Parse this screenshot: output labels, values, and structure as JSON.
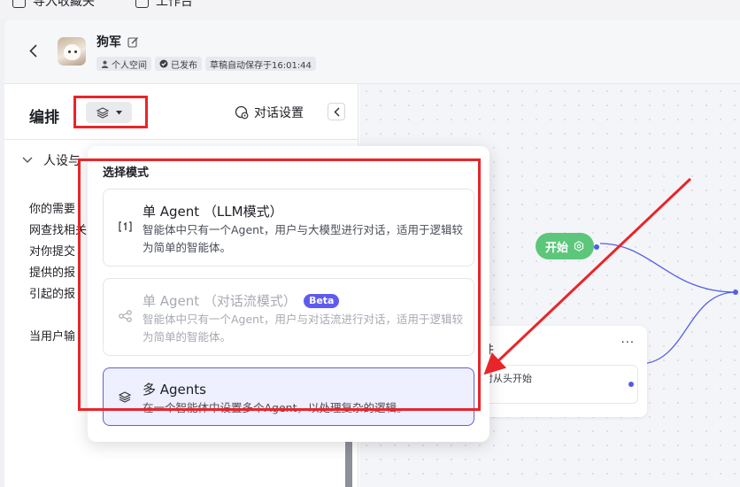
{
  "topbar": {
    "import_label": "导入收藏夹",
    "workbench_label": "工作台"
  },
  "header": {
    "bot_name": "狗军",
    "badges": {
      "space": "个人空间",
      "status": "已发布",
      "autosave": "草稿自动保存于16:01:44"
    }
  },
  "left_panel": {
    "title": "编排",
    "chat_settings_label": "对话设置",
    "section_label": "人设与",
    "prompt_lines": [
      "你的需要",
      "网查找相关",
      "对你提交",
      "提供的报",
      "引起的报",
      "",
      "当用户输"
    ]
  },
  "dropdown": {
    "title": "选择模式",
    "options": [
      {
        "title": "单 Agent （LLM模式）",
        "desc": "智能体中只有一个Agent，用户与大模型进行对话，适用于逻辑较为简单的智能体。",
        "state": "normal"
      },
      {
        "title": "单 Agent （对话流模式）",
        "badge": "Beta",
        "desc": "智能体中只有一个Agent，用户与对话流进行对话，适用于逻辑较为简单的智能体。",
        "state": "disabled"
      },
      {
        "title": "多 Agents",
        "desc": "在一个智能体中设置多个Agent，以处理复杂的逻辑。",
        "state": "selected"
      }
    ]
  },
  "canvas": {
    "start_label": "开始",
    "plugin_title": "件",
    "plugin_more": "···",
    "plugin_text": "对从头开始"
  },
  "colors": {
    "highlight": "#e8252a",
    "start_node": "#5cc77a",
    "accent": "#5e61d6",
    "edge": "#5560e6"
  }
}
